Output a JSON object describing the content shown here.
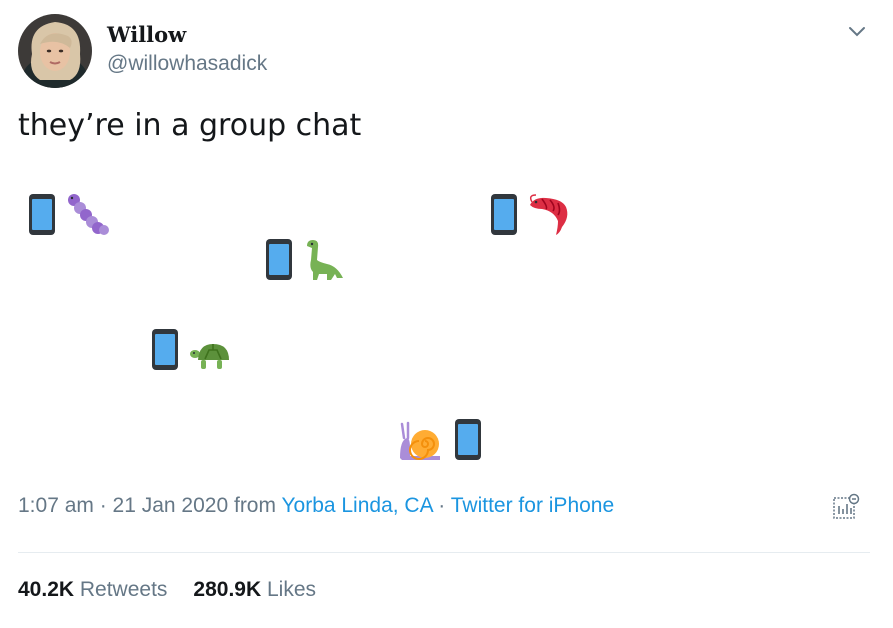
{
  "author": {
    "display_name": "Willow",
    "handle": "@willowhasadick"
  },
  "tweet": {
    "text": "they’re in a group chat",
    "emoji": [
      {
        "animal": "caterpillar-icon",
        "device": "mobile-phone-icon"
      },
      {
        "animal": "shrimp-icon",
        "device": "mobile-phone-icon"
      },
      {
        "animal": "dinosaur-icon",
        "device": "mobile-phone-icon"
      },
      {
        "animal": "turtle-icon",
        "device": "mobile-phone-icon"
      },
      {
        "animal": "snail-icon",
        "device": "mobile-phone-icon"
      }
    ]
  },
  "meta": {
    "timestamp": "1:07 am · 21 Jan 2020 from ",
    "location": "Yorba Linda, CA",
    "separator": " · ",
    "source": "Twitter for iPhone"
  },
  "stats": {
    "retweets_count": "40.2K",
    "retweets_label": " Retweets",
    "likes_count": "280.9K",
    "likes_label": " Likes"
  },
  "colors": {
    "text": "#14171a",
    "secondary": "#657786",
    "link": "#1b95e0",
    "divider": "#e6ecf0"
  }
}
